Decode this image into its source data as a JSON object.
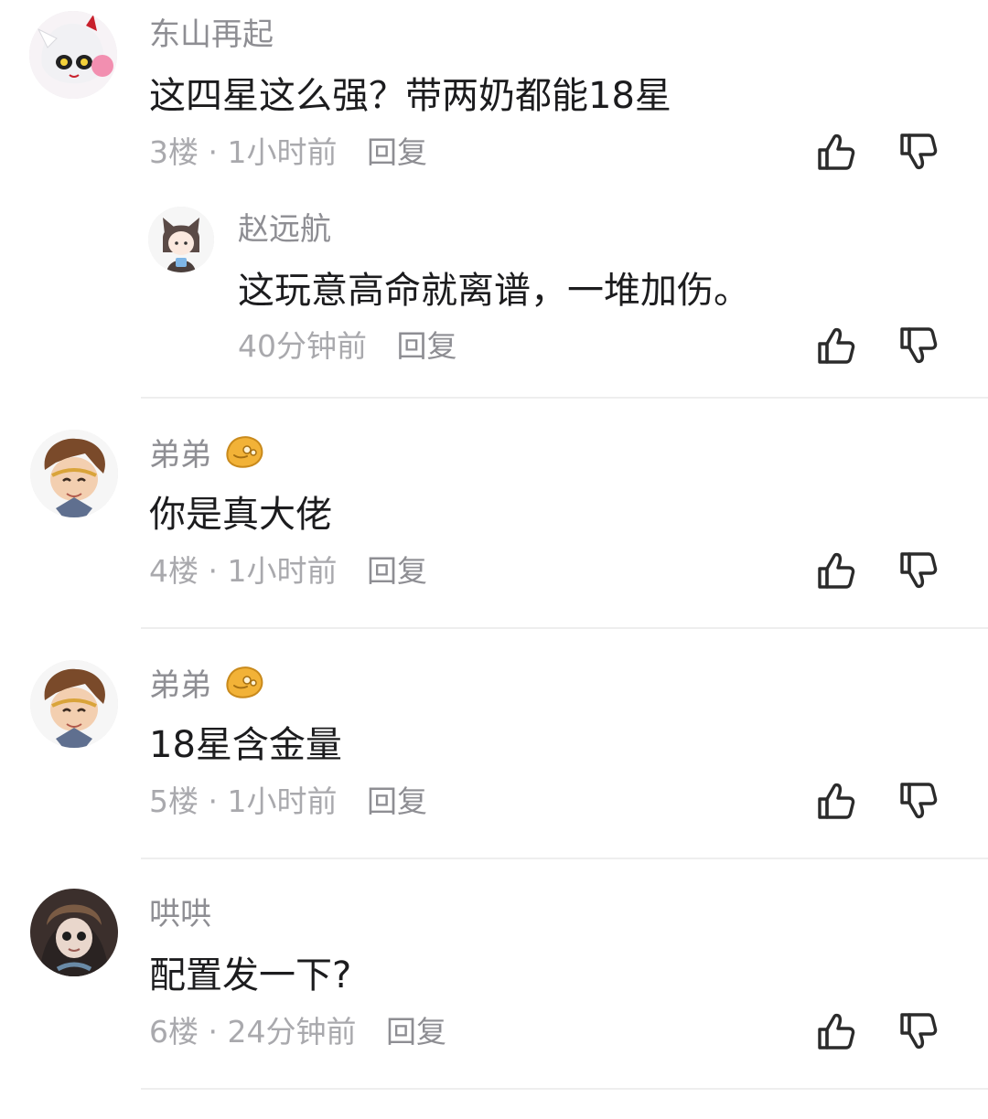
{
  "comments": [
    {
      "username": "东山再起",
      "content": "这四星这么强？带两奶都能18星",
      "floor": "3楼",
      "time": "1小时前",
      "reply_label": "回复",
      "replies": [
        {
          "username": "赵远航",
          "content": "这玩意高命就离谱，一堆加伤。",
          "time": "40分钟前",
          "reply_label": "回复"
        }
      ]
    },
    {
      "username": "弟弟",
      "content": "你是真大佬",
      "floor": "4楼",
      "time": "1小时前",
      "reply_label": "回复"
    },
    {
      "username": "弟弟",
      "content": "18星含金量",
      "floor": "5楼",
      "time": "1小时前",
      "reply_label": "回复"
    },
    {
      "username": "哄哄",
      "content": "配置发一下?",
      "floor": "6楼",
      "time": "24分钟前",
      "reply_label": "回复"
    }
  ],
  "meta_separator": "·",
  "icons": {
    "like": "thumbs-up-icon",
    "dislike": "thumbs-down-icon",
    "badge": "gold-mooncake-badge-icon"
  },
  "colors": {
    "username": "#8e8e93",
    "content": "#1c1c1e",
    "meta": "#a9a9ad",
    "icon": "#2b2b2b",
    "divider": "#eeeeee",
    "badge": "#f2b237"
  }
}
